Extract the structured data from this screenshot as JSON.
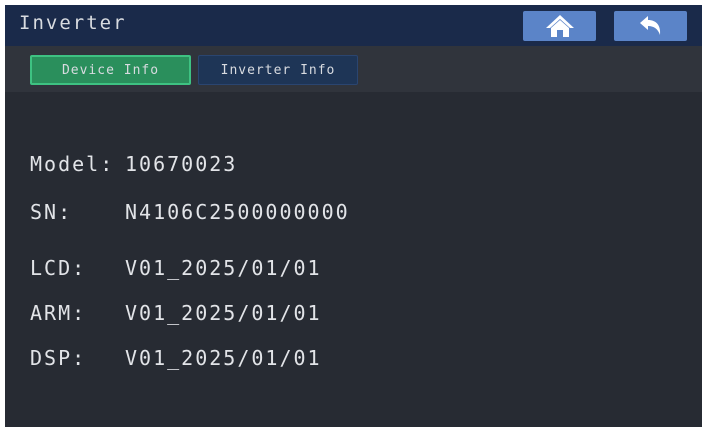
{
  "header": {
    "title": "Inverter",
    "home_icon": "home-icon",
    "back_icon": "back-arrow-icon"
  },
  "tabs": [
    {
      "label": "Device Info",
      "active": true
    },
    {
      "label": "Inverter Info",
      "active": false
    }
  ],
  "info": {
    "model": {
      "label": "Model:",
      "value": "10670023"
    },
    "sn": {
      "label": "SN:",
      "value": "N4106C2500000000"
    },
    "lcd": {
      "label": "LCD:",
      "value": "V01_2025/01/01"
    },
    "arm": {
      "label": "ARM:",
      "value": "V01_2025/01/01"
    },
    "dsp": {
      "label": "DSP:",
      "value": "V01_2025/01/01"
    }
  },
  "colors": {
    "background": "#272b33",
    "title_bar": "#1a2a4a",
    "button": "#5b84c8",
    "active_tab": "#2a8f5c",
    "inactive_tab": "#1e3556"
  }
}
